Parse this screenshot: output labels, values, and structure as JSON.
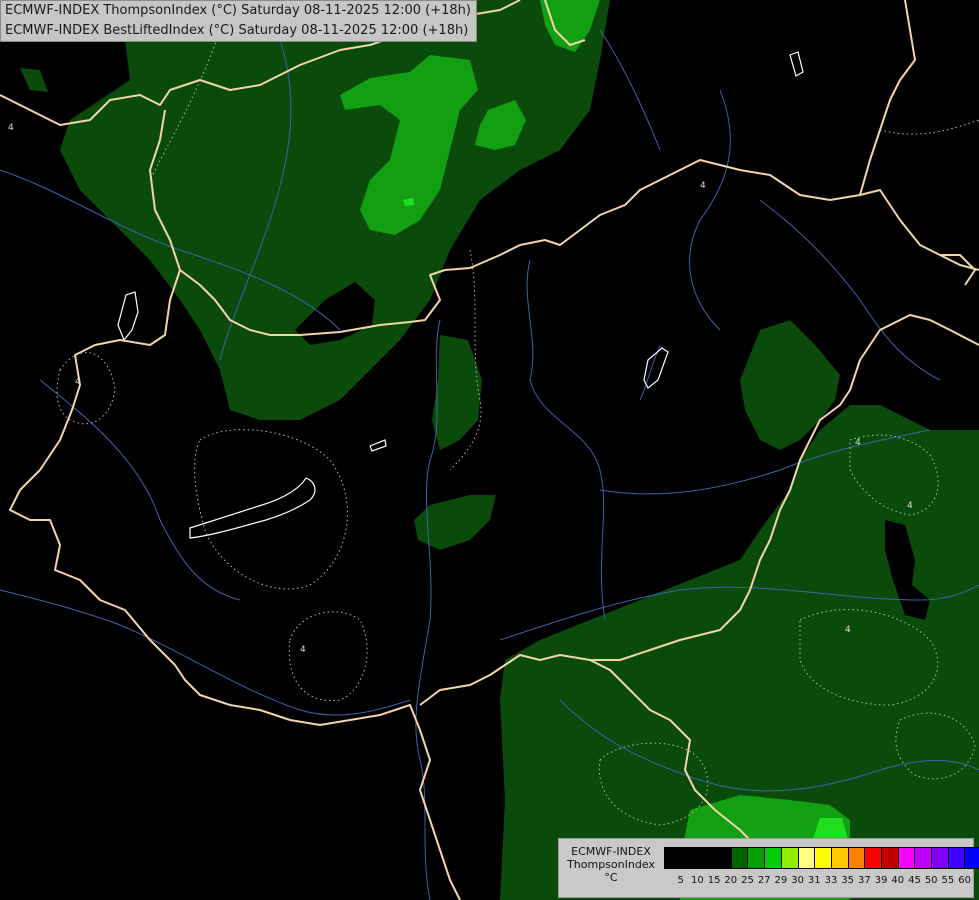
{
  "header": {
    "line1": "ECMWF-INDEX ThompsonIndex (°C) Saturday 08-11-2025 12:00 (+18h)",
    "line2": "ECMWF-INDEX BestLiftedIndex (°C) Saturday 08-11-2025 12:00 (+18h)"
  },
  "legend": {
    "title_line1": "ECMWF-INDEX",
    "title_line2": "ThompsonIndex",
    "title_line3": "°C",
    "ticks": [
      "5",
      "10",
      "15",
      "20",
      "25",
      "27",
      "29",
      "30",
      "31",
      "33",
      "35",
      "37",
      "39",
      "40",
      "45",
      "50",
      "55",
      "60"
    ],
    "colors": [
      "#000000",
      "#000000",
      "#000000",
      "#000000",
      "#006400",
      "#00a000",
      "#00d000",
      "#90ee00",
      "#ffff80",
      "#ffff00",
      "#ffc800",
      "#ff8000",
      "#ff0000",
      "#c00000",
      "#ff00ff",
      "#c000ff",
      "#8000ff",
      "#4000ff",
      "#0000ff"
    ]
  },
  "map": {
    "colors": {
      "background": "#000000",
      "shade_dark": "#0a4a0a",
      "shade_medium": "#0e6b12",
      "shade_bright": "#12a012",
      "shade_vivid": "#1ee01e",
      "borders": "#f0d6a8",
      "rivers": "#3b63a8",
      "contours": "#bbbbbb"
    },
    "contour_labels": [
      "4",
      "4",
      "4",
      "4",
      "4",
      "4",
      "4"
    ]
  }
}
